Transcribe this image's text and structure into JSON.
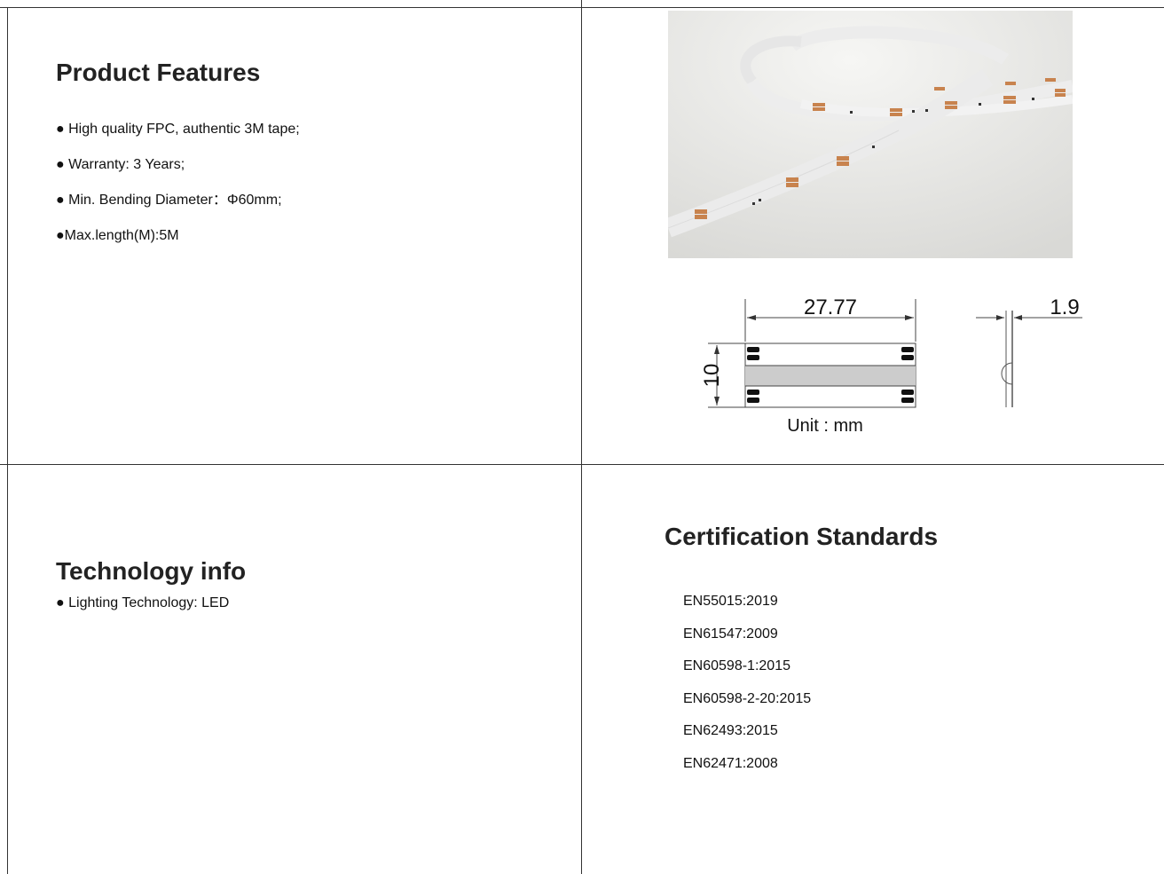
{
  "features": {
    "title": "Product Features",
    "items": [
      "● High quality FPC, authentic 3M tape;",
      "● Warranty: 3 Years;",
      "● Min. Bending Diameter：Φ60mm;",
      "●Max.length(M):5M"
    ]
  },
  "technology": {
    "title": "Technology info",
    "items": [
      "● Lighting Technology: LED"
    ]
  },
  "certification": {
    "title": "Certification Standards",
    "items": [
      "EN55015:2019",
      "EN61547:2009",
      "EN60598-1:2015",
      "EN60598-2-20:2015",
      "EN62493:2015",
      "EN62471:2008"
    ]
  },
  "drawing": {
    "length": "27.77",
    "width": "10",
    "thickness": "1.9",
    "unit": "Unit : mm"
  }
}
